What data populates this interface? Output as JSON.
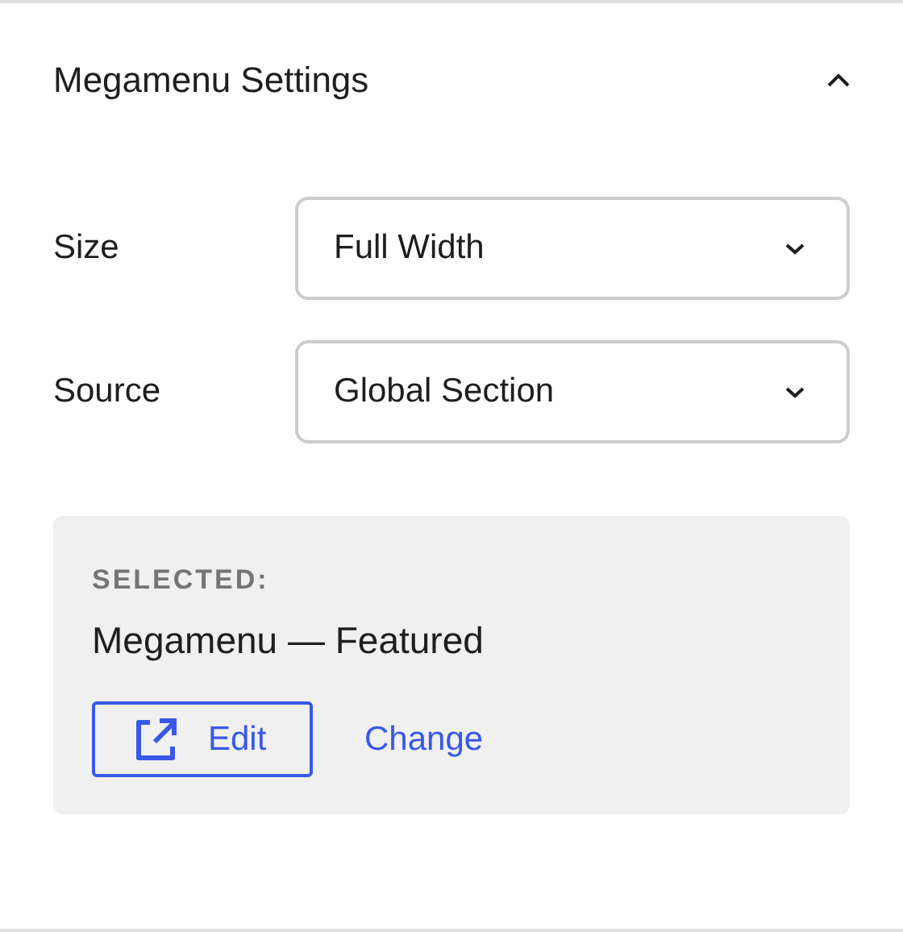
{
  "panel": {
    "title": "Megamenu Settings",
    "expanded": true
  },
  "fields": [
    {
      "label": "Size",
      "value": "Full Width"
    },
    {
      "label": "Source",
      "value": "Global Section"
    }
  ],
  "selection": {
    "heading": "SELECTED:",
    "value": "Megamenu — Featured",
    "edit_button": "Edit",
    "change_link": "Change"
  }
}
